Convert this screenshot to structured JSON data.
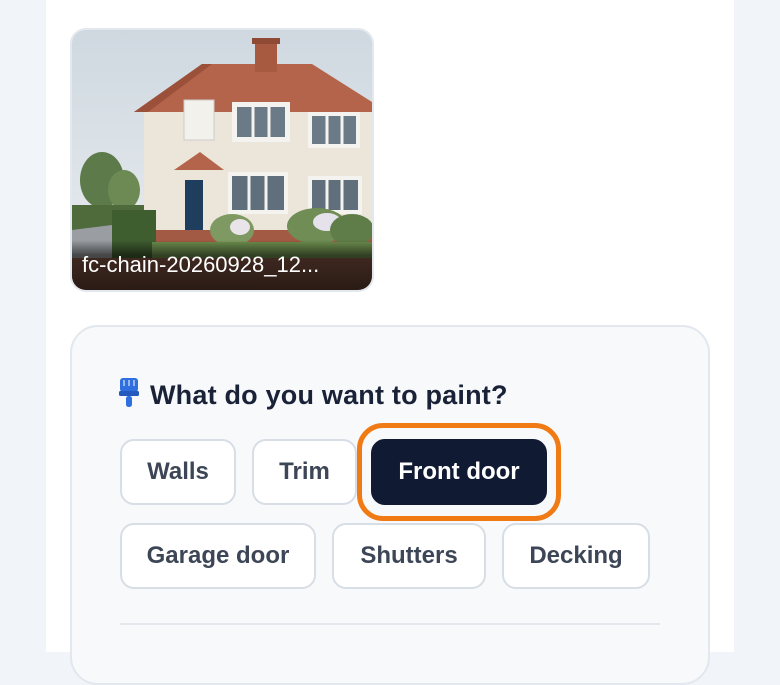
{
  "upload": {
    "filename": "fc-chain-20260928_12..."
  },
  "paint_section": {
    "title": "What do you want to paint?",
    "options": [
      {
        "label": "Walls",
        "selected": false
      },
      {
        "label": "Trim",
        "selected": false
      },
      {
        "label": "Front door",
        "selected": true
      },
      {
        "label": "Garage door",
        "selected": false
      },
      {
        "label": "Shutters",
        "selected": false
      },
      {
        "label": "Decking",
        "selected": false
      }
    ]
  },
  "colors": {
    "selected_chip": "#111a33",
    "highlight": "#f07a13",
    "paint_icon": "#2f6fe0"
  },
  "icons": {
    "title_icon": "paint-brush-icon"
  }
}
